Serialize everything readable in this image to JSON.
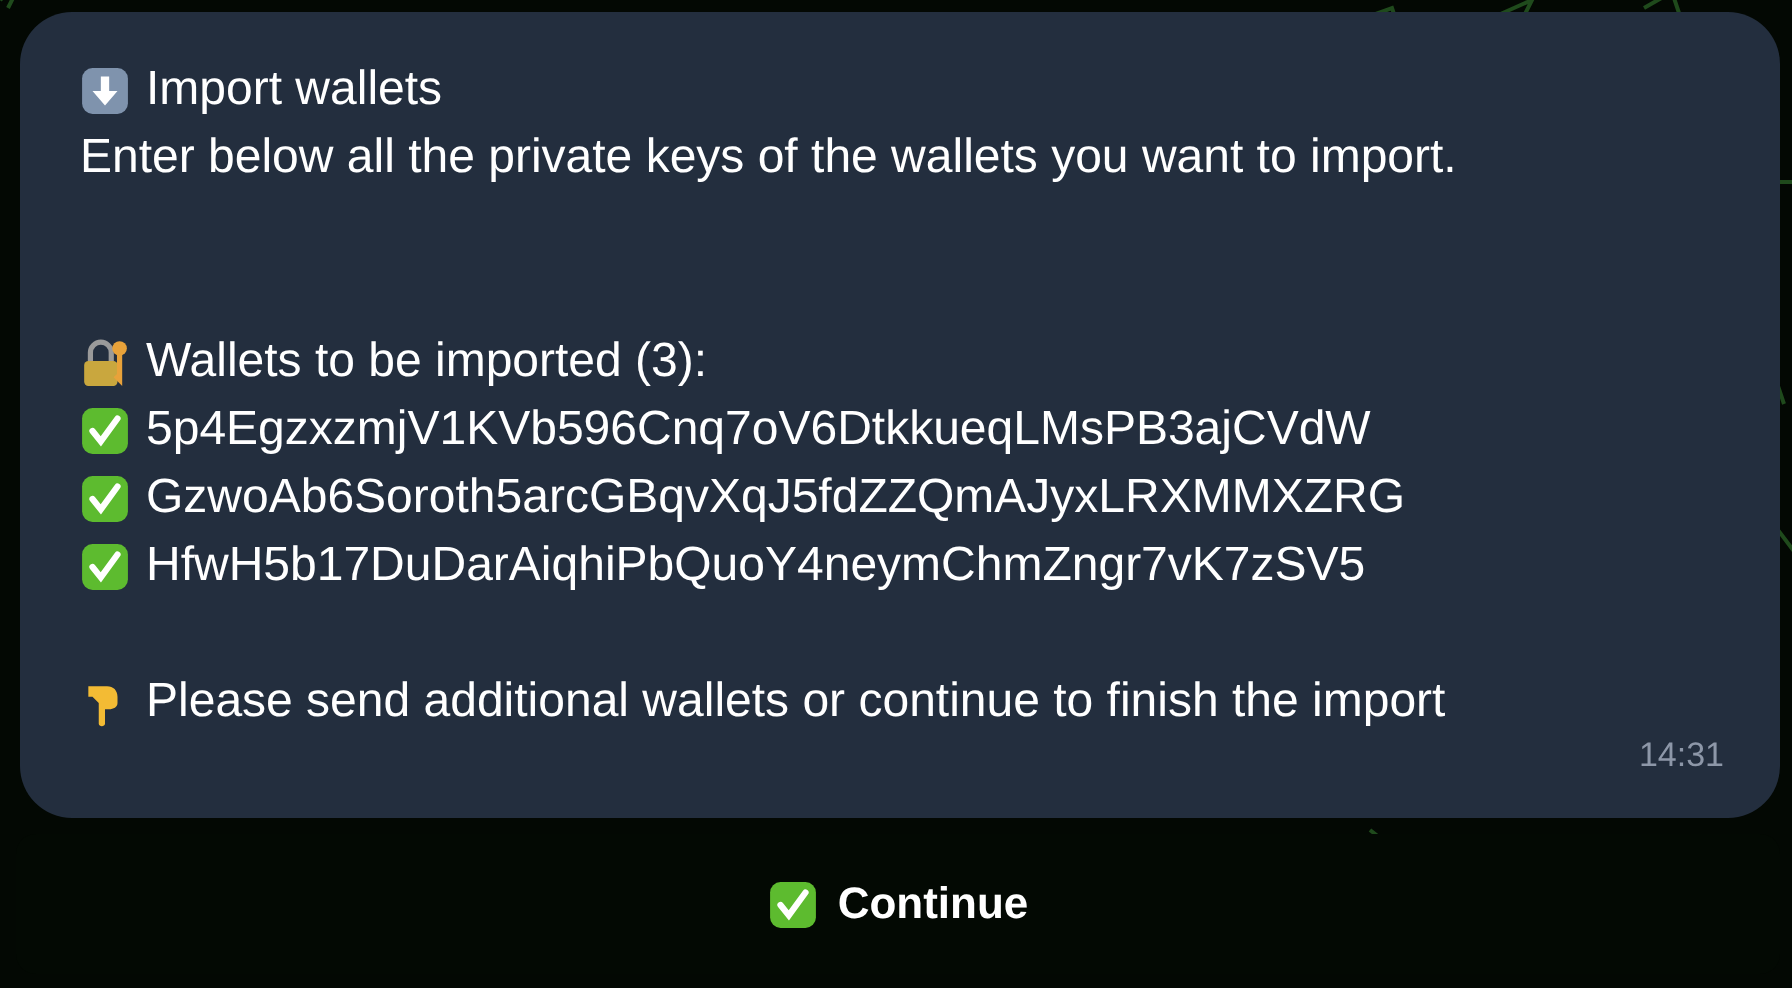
{
  "message": {
    "title": "Import wallets",
    "description": "Enter below all the private keys of the wallets you want to import.",
    "wallets_header": "Wallets to be imported (3):",
    "wallets": [
      {
        "key": "5p4EgzxzmjV1KVb596Cnq7oV6DtkkueqLMsPB3ajCVdW"
      },
      {
        "key": "GzwoAb6Soroth5arcGBqvXqJ5fdZZQmAJyxLRXMMXZRG"
      },
      {
        "key": "HfwH5b17DuDarAiqhiPbQuoY4neymChmZngr7vK7zSV5"
      }
    ],
    "hint": "Please send additional wallets or continue to finish the import",
    "time": "14:31"
  },
  "buttons": [
    {
      "label": "Continue"
    }
  ]
}
